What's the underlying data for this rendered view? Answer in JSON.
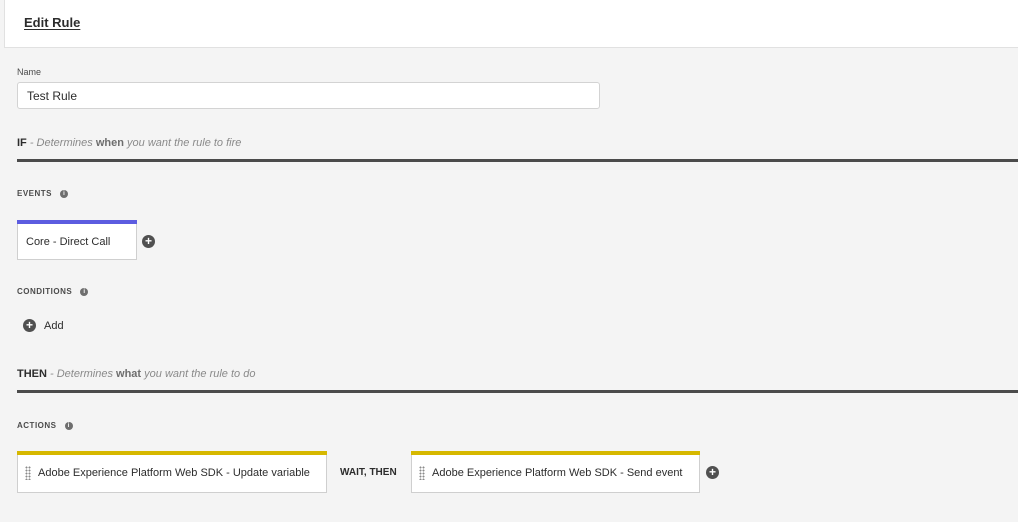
{
  "header": {
    "title": "Edit Rule"
  },
  "name_field": {
    "label": "Name",
    "value": "Test Rule"
  },
  "if_section": {
    "keyword": "IF",
    "desc_pre": " - Determines ",
    "desc_em": "when",
    "desc_post": " you want the rule to fire"
  },
  "events": {
    "label": "EVENTS",
    "items": [
      {
        "label": "Core - Direct Call",
        "accent": "#5c5ce0"
      }
    ]
  },
  "conditions": {
    "label": "CONDITIONS",
    "add_label": "Add"
  },
  "then_section": {
    "keyword": "THEN",
    "desc_pre": " - Determines ",
    "desc_em": "what",
    "desc_post": " you want the rule to do"
  },
  "actions": {
    "label": "ACTIONS",
    "items": [
      {
        "label": "Adobe Experience Platform Web SDK - Update variable",
        "accent": "#d6b800"
      },
      {
        "label": "Adobe Experience Platform Web SDK - Send event",
        "accent": "#d6b800"
      }
    ],
    "separator": "WAIT, THEN"
  },
  "icons": {
    "info": "info-icon",
    "add": "plus-circle-icon",
    "drag": "drag-handle-icon"
  }
}
